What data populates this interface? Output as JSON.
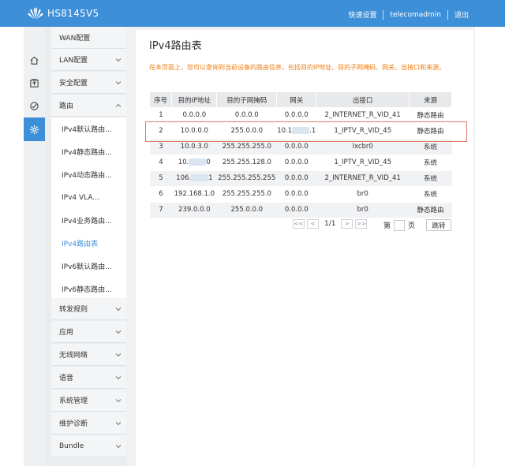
{
  "header": {
    "device": "HS8145V5",
    "quick_setup": "快速设置",
    "user": "telecomadmin",
    "logout": "退出"
  },
  "colors": {
    "brand": "#3d8fd8",
    "accent_text": "#ee7d14",
    "highlight_border": "#e07a66"
  },
  "rail_icons": [
    "home-icon",
    "upload-icon",
    "gauge-icon",
    "gear-icon"
  ],
  "menu": {
    "wan": "WAN配置",
    "lan": "LAN配置",
    "security": "安全配置",
    "route": "路由",
    "route_sub": [
      "IPv4默认路由...",
      "IPv4静态路由...",
      "IPv4动态路由...",
      "IPv4 VLA...",
      "IPv4业务路由...",
      "IPv4路由表",
      "IPv6默认路由...",
      "IPv6静态路由..."
    ],
    "forward": "转发规则",
    "app": "应用",
    "wlan": "无线网络",
    "voice": "语音",
    "sysmgmt": "系统管理",
    "maint": "维护诊断",
    "bundle": "Bundle"
  },
  "page": {
    "title": "IPv4路由表",
    "description": "在本页面上，您可以查询到当前设备的路由信息，包括目的IP地址、目的子网掩码、网关、出接口和来源。"
  },
  "table": {
    "headers": [
      "序号",
      "目的IP地址",
      "目的子网掩码",
      "网关",
      "出接口",
      "来源"
    ],
    "rows": [
      [
        "1",
        "0.0.0.0",
        "0.0.0.0",
        "0.0.0.0",
        "2_INTERNET_R_VID_41",
        "静态路由"
      ],
      [
        "2",
        "10.0.0.0",
        "255.0.0.0",
        "10.1",
        "1_IPTV_R_VID_45",
        "静态路由"
      ],
      [
        "3",
        "10.0.3.0",
        "255.255.255.0",
        "0.0.0.0",
        "lxcbr0",
        "系统"
      ],
      [
        "4",
        "10.",
        "255.255.128.0",
        "0.0.0.0",
        "1_IPTV_R_VID_45",
        "系统"
      ],
      [
        "5",
        "106.",
        "255.255.255.255",
        "0.0.0.0",
        "2_INTERNET_R_VID_41",
        "系统"
      ],
      [
        "6",
        "192.168.1.0",
        "255.255.255.0",
        "0.0.0.0",
        "br0",
        "系统"
      ],
      [
        "7",
        "239.0.0.0",
        "255.0.0.0",
        "0.0.0.0",
        "br0",
        "静态路由"
      ]
    ],
    "row2_gateway_tail": ".1",
    "row4_ip_tail": "0",
    "row5_ip_tail": "1"
  },
  "pager": {
    "first": "<<",
    "prev": "<",
    "indicator": "1/1",
    "next": ">",
    "last": ">>",
    "page_label": "第",
    "page_unit": "页",
    "jump": "跳转"
  }
}
